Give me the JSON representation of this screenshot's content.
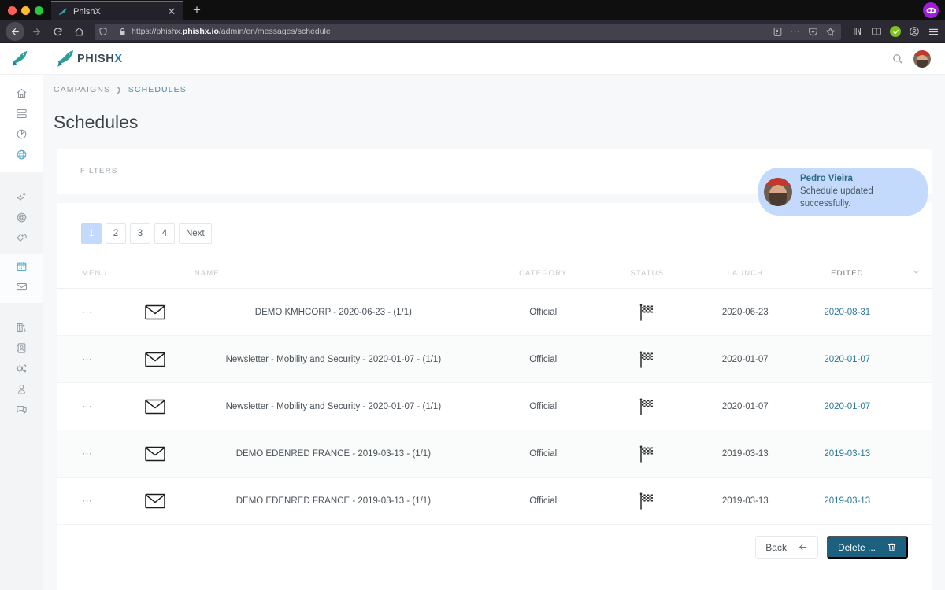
{
  "browser": {
    "tab": {
      "title": "PhishX",
      "favicon_icon": "phishx-fish-icon",
      "close_icon": "close-icon"
    },
    "new_tab_label": "+",
    "nav": {
      "back_icon": "back-arrow-icon",
      "forward_icon": "forward-arrow-icon",
      "reload_icon": "reload-icon",
      "home_icon": "home-icon"
    },
    "url": {
      "shield_icon": "shield-icon",
      "lock_icon": "padlock-icon",
      "prefix": "https://phishx.",
      "domain": "phishx.io",
      "path": "/admin/en/messages/schedule",
      "reader_icon": "reader-view-icon",
      "ellipsis_icon": "page-actions-icon",
      "pocket_icon": "pocket-icon",
      "bookmark_icon": "star-bookmark-icon"
    },
    "toolbar": {
      "library_icon": "library-icon",
      "sidebar_icon": "sidebar-icon",
      "shield_check_icon": "green-check-icon",
      "account_icon": "account-icon",
      "menu_icon": "hamburger-menu-icon"
    },
    "extension_icon": "mask-extension-icon"
  },
  "app": {
    "logo": {
      "mark_icon": "phishx-fish-logo",
      "word": "PHISH",
      "word_accent": "X"
    },
    "header_actions": {
      "search_icon": "search-icon",
      "avatar_icon": "user-avatar"
    }
  },
  "sidebar": {
    "groups": [
      {
        "items": [
          {
            "name": "sidebar-item-home",
            "icon": "home-icon"
          },
          {
            "name": "sidebar-item-dashboard",
            "icon": "server-rack-icon"
          },
          {
            "name": "sidebar-item-reports",
            "icon": "pie-chart-icon"
          },
          {
            "name": "sidebar-item-targets",
            "icon": "target-globe-icon",
            "active": true
          }
        ]
      },
      {
        "items": [
          {
            "name": "sidebar-item-campaigns",
            "icon": "magic-star-icon"
          },
          {
            "name": "sidebar-item-goals",
            "icon": "bullseye-icon"
          },
          {
            "name": "sidebar-item-tags",
            "icon": "tags-icon"
          }
        ]
      },
      {
        "items": [
          {
            "name": "sidebar-item-schedules",
            "icon": "calendar-icon",
            "active": true
          },
          {
            "name": "sidebar-item-messages",
            "icon": "envelope-icon"
          }
        ]
      },
      {
        "items": [
          {
            "name": "sidebar-item-library",
            "icon": "books-icon"
          },
          {
            "name": "sidebar-item-contacts",
            "icon": "contact-card-icon"
          },
          {
            "name": "sidebar-item-integrations",
            "icon": "gear-share-icon"
          },
          {
            "name": "sidebar-item-users",
            "icon": "user-icon"
          },
          {
            "name": "sidebar-item-support",
            "icon": "chat-bubbles-icon"
          }
        ]
      }
    ]
  },
  "breadcrumb": {
    "parent": "CAMPAIGNS",
    "separator": "❯",
    "current": "SCHEDULES"
  },
  "page": {
    "title": "Schedules"
  },
  "toast": {
    "avatar_icon": "user-avatar",
    "name": "Pedro Vieira",
    "message": "Schedule updated successfully."
  },
  "filters": {
    "label": "FILTERS",
    "menu_icon": "ellipsis-icon"
  },
  "pagination": {
    "pages": [
      "1",
      "2",
      "3",
      "4"
    ],
    "active": "1",
    "next_label": "Next"
  },
  "table": {
    "columns": {
      "menu": "MENU",
      "name": "NAME",
      "category": "CATEGORY",
      "status": "STATUS",
      "launch": "LAUNCH",
      "edited": "EDITED"
    },
    "sort_icon": "chevron-down-icon",
    "row_menu_icon": "ellipsis-icon",
    "type_icon": "envelope-icon",
    "status_icon": "checkered-flag-icon",
    "rows": [
      {
        "name": "DEMO KMHCORP - 2020-06-23 - (1/1)",
        "category": "Official",
        "status": "checkered-flag-icon",
        "launch": "2020-06-23",
        "edited": "2020-08-31"
      },
      {
        "name": "Newsletter - Mobility and Security - 2020-01-07 - (1/1)",
        "category": "Official",
        "status": "checkered-flag-icon",
        "launch": "2020-01-07",
        "edited": "2020-01-07"
      },
      {
        "name": "Newsletter - Mobility and Security - 2020-01-07 - (1/1)",
        "category": "Official",
        "status": "checkered-flag-icon",
        "launch": "2020-01-07",
        "edited": "2020-01-07"
      },
      {
        "name": "DEMO EDENRED FRANCE - 2019-03-13 - (1/1)",
        "category": "Official",
        "status": "checkered-flag-icon",
        "launch": "2019-03-13",
        "edited": "2019-03-13"
      },
      {
        "name": "DEMO EDENRED FRANCE - 2019-03-13 - (1/1)",
        "category": "Official",
        "status": "checkered-flag-icon",
        "launch": "2019-03-13",
        "edited": "2019-03-13"
      }
    ]
  },
  "footer": {
    "back_label": "Back",
    "back_icon": "left-arrow-icon",
    "delete_label": "Delete ...",
    "delete_icon": "trash-icon"
  },
  "colors": {
    "accent_teal": "#1b607f",
    "link_teal": "#2c7a9b",
    "toast_bg": "#c3dafc",
    "page_bg": "#f7f8f9"
  }
}
